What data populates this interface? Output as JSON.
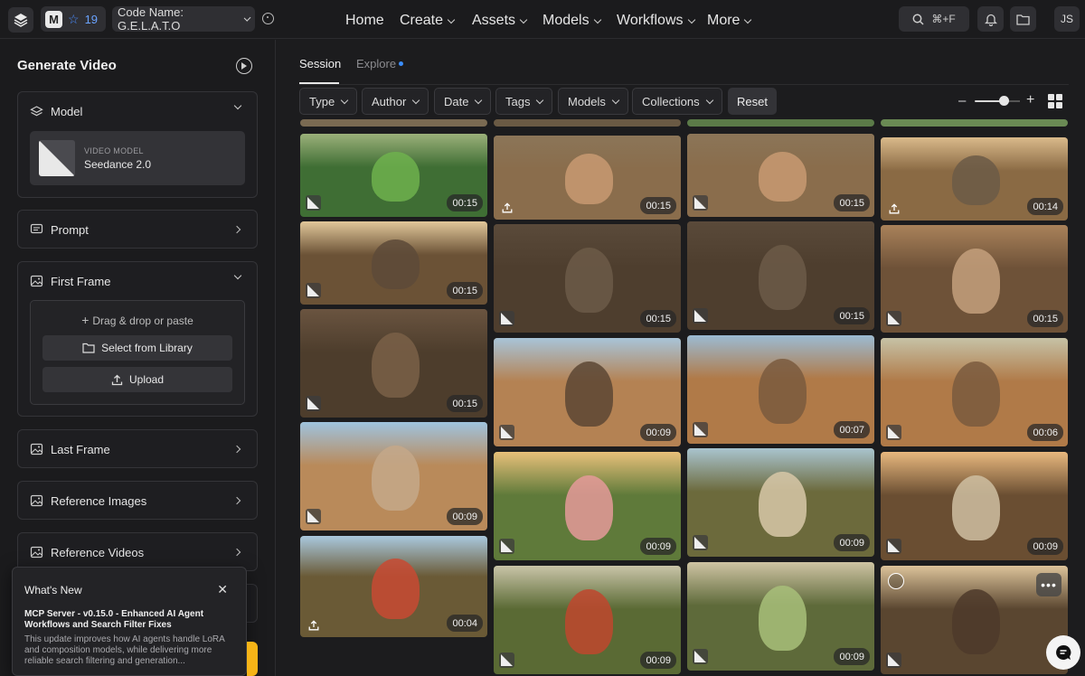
{
  "topbar": {
    "workspace_initial": "M",
    "star_count": "19",
    "project_name": "Code Name: G.E.L.A.T.O",
    "nav": [
      "Home",
      "Create",
      "Assets",
      "Models",
      "Workflows",
      "More"
    ],
    "search_shortcut": "⌘+F",
    "user_initials": "JS"
  },
  "sidebar": {
    "title": "Generate Video",
    "model_section": "Model",
    "model_kind": "VIDEO MODEL",
    "model_name": "Seedance 2.0",
    "prompt_section": "Prompt",
    "first_frame_section": "First Frame",
    "drag_drop_text": "Drag & drop or paste",
    "select_library_label": "Select from Library",
    "upload_label": "Upload",
    "last_frame_section": "Last Frame",
    "reference_images_section": "Reference Images",
    "reference_videos_section": "Reference Videos"
  },
  "whats_new": {
    "title": "What's New",
    "headline": "MCP Server - v0.15.0 - Enhanced AI Agent Workflows and Search Filter Fixes",
    "body": "This update improves how AI agents handle LoRA and composition models, while delivering more reliable search filtering and generation..."
  },
  "main": {
    "tabs": [
      "Session",
      "Explore"
    ],
    "filters": [
      "Type",
      "Author",
      "Date",
      "Tags",
      "Models",
      "Collections"
    ],
    "reset_label": "Reset"
  },
  "gallery": [
    {
      "duration": "00:15",
      "sky": "#9bb07a",
      "ground": "#3f6e34",
      "fig": "#6fb24e",
      "badge": "mark"
    },
    {
      "duration": "00:15",
      "sky": "#8b7558",
      "ground": "#8a6d4c",
      "fig": "#c89a72",
      "badge": "upload"
    },
    {
      "duration": "00:15",
      "sky": "#8b7558",
      "ground": "#8a6d4c",
      "fig": "#c89a72",
      "badge": "mark"
    },
    {
      "duration": "00:14",
      "sky": "#d9b98a",
      "ground": "#8a6a44",
      "fig": "#6b5a46",
      "badge": "upload"
    },
    {
      "duration": "00:15",
      "sky": "#e1c79a",
      "ground": "#6b5236",
      "fig": "#5d4a38",
      "badge": "mark"
    },
    {
      "duration": "00:15",
      "sky": "#5a4a3a",
      "ground": "#4e3e2e",
      "fig": "#6c5a48",
      "badge": "mark"
    },
    {
      "duration": "00:15",
      "sky": "#5a4a3a",
      "ground": "#4e3e2e",
      "fig": "#6c5a48",
      "badge": "mark"
    },
    {
      "duration": "00:15",
      "sky": "#a9825a",
      "ground": "#6e5238",
      "fig": "#c4a07c",
      "badge": "mark"
    },
    {
      "duration": "00:15",
      "sky": "#6a5440",
      "ground": "#4d3d2c",
      "fig": "#7a6048",
      "badge": "mark"
    },
    {
      "duration": "00:09",
      "sky": "#a8c4d8",
      "ground": "#b48253",
      "fig": "#5c4634",
      "badge": "mark"
    },
    {
      "duration": "00:07",
      "sky": "#9bbbd3",
      "ground": "#b07a48",
      "fig": "#7a5a3e",
      "badge": "mark"
    },
    {
      "duration": "00:06",
      "sky": "#c6c2a6",
      "ground": "#b07a48",
      "fig": "#7a5a3e",
      "badge": "mark"
    },
    {
      "duration": "00:09",
      "sky": "#9fc3de",
      "ground": "#b98a5a",
      "fig": "#c4a88a",
      "badge": "mark"
    },
    {
      "duration": "00:09",
      "sky": "#e8c07a",
      "ground": "#5f7a3a",
      "fig": "#e59a9a",
      "badge": "mark"
    },
    {
      "duration": "00:09",
      "sky": "#a9c4cf",
      "ground": "#6c6a3c",
      "fig": "#d8c8a8",
      "badge": "mark"
    },
    {
      "duration": "00:09",
      "sky": "#e8b87e",
      "ground": "#6a4e32",
      "fig": "#cfc0a2",
      "badge": "mark"
    },
    {
      "duration": "00:04",
      "sky": "#a9c8de",
      "ground": "#6a5a36",
      "fig": "#c84a32",
      "badge": "upload"
    },
    {
      "duration": "00:09",
      "sky": "#c9c4a8",
      "ground": "#5a6a34",
      "fig": "#c0462e",
      "badge": "mark"
    },
    {
      "duration": "00:09",
      "sky": "#cfc4a4",
      "ground": "#5e6a3a",
      "fig": "#a8c07a",
      "badge": "mark"
    },
    {
      "duration": "",
      "sky": "#dcc39a",
      "ground": "#5a4630",
      "fig": "#4e3a2a",
      "badge": "mark"
    }
  ],
  "icons": {
    "logo": "layers-logo-icon",
    "search": "search-icon",
    "bell": "bell-icon",
    "folder": "folder-icon",
    "grid": "grid-view-icon",
    "chat": "chat-icon"
  },
  "colors": {
    "accent_blue": "#3b8eff",
    "upgrade_yellow": "#f6b417"
  }
}
